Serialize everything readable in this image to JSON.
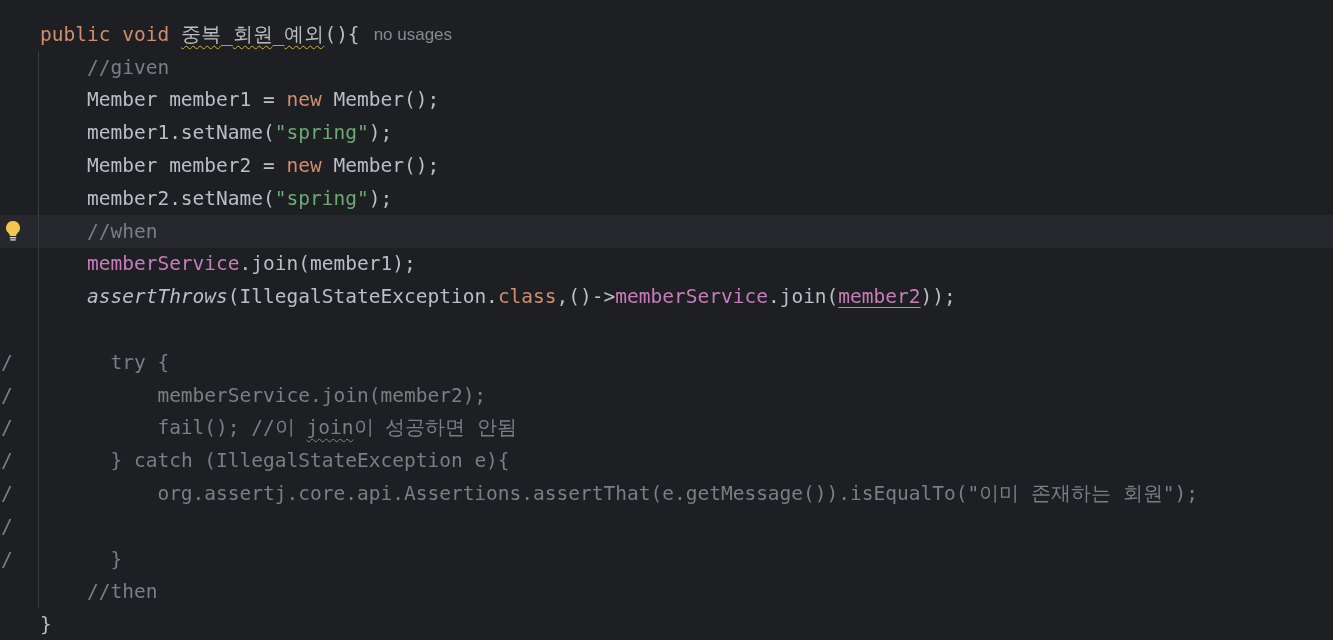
{
  "editor": {
    "header": {
      "tokens": [
        {
          "kind": "keyword",
          "text": "public void "
        },
        {
          "kind": "plain",
          "text": "중복",
          "warning": true
        },
        {
          "kind": "plain",
          "text": "_"
        },
        {
          "kind": "plain",
          "text": "회원",
          "warning": true
        },
        {
          "kind": "plain",
          "text": "_"
        },
        {
          "kind": "plain",
          "text": "예외",
          "warning": true
        },
        {
          "kind": "plain",
          "text": "(){"
        }
      ],
      "hint": "no usages"
    },
    "body": [
      {
        "kind": "statement",
        "current": false,
        "bulb": false,
        "tokens": [
          {
            "kind": "comment",
            "text": "//given"
          }
        ]
      },
      {
        "kind": "statement",
        "current": false,
        "bulb": false,
        "tokens": [
          {
            "kind": "plain",
            "text": "Member member1 = "
          },
          {
            "kind": "keyword",
            "text": "new"
          },
          {
            "kind": "plain",
            "text": " Member();"
          }
        ]
      },
      {
        "kind": "statement",
        "current": false,
        "bulb": false,
        "tokens": [
          {
            "kind": "plain",
            "text": "member1.setName("
          },
          {
            "kind": "string",
            "text": "\"spring\""
          },
          {
            "kind": "plain",
            "text": ");"
          }
        ]
      },
      {
        "kind": "statement",
        "current": false,
        "bulb": false,
        "tokens": [
          {
            "kind": "plain",
            "text": "Member member2 = "
          },
          {
            "kind": "keyword",
            "text": "new"
          },
          {
            "kind": "plain",
            "text": " Member();"
          }
        ]
      },
      {
        "kind": "statement",
        "current": false,
        "bulb": false,
        "tokens": [
          {
            "kind": "plain",
            "text": "member2.setName("
          },
          {
            "kind": "string",
            "text": "\"spring\""
          },
          {
            "kind": "plain",
            "text": ");"
          }
        ]
      },
      {
        "kind": "statement",
        "current": true,
        "bulb": true,
        "tokens": [
          {
            "kind": "comment",
            "text": "//when"
          }
        ]
      },
      {
        "kind": "statement",
        "current": false,
        "bulb": false,
        "tokens": [
          {
            "kind": "field",
            "text": "memberService"
          },
          {
            "kind": "plain",
            "text": ".join(member1);"
          }
        ]
      },
      {
        "kind": "statement",
        "current": false,
        "bulb": false,
        "tokens": [
          {
            "kind": "italic",
            "text": "assertThrows"
          },
          {
            "kind": "plain",
            "text": "(IllegalStateException."
          },
          {
            "kind": "keyword",
            "text": "class"
          },
          {
            "kind": "plain",
            "text": ",()->"
          },
          {
            "kind": "field",
            "text": "memberService"
          },
          {
            "kind": "plain",
            "text": ".join("
          },
          {
            "kind": "field",
            "text": "member2",
            "underlined": true
          },
          {
            "kind": "plain",
            "text": "));"
          }
        ]
      },
      {
        "kind": "blank",
        "current": false,
        "bulb": false
      },
      {
        "kind": "block",
        "current": false,
        "bulb": false,
        "gutter": "/",
        "tokens": [
          {
            "kind": "comment",
            "text": "try {"
          }
        ]
      },
      {
        "kind": "inner",
        "current": false,
        "bulb": false,
        "gutter": "/",
        "tokens": [
          {
            "kind": "comment",
            "text": "memberService.join(member2);"
          }
        ]
      },
      {
        "kind": "inner",
        "current": false,
        "bulb": false,
        "gutter": "/",
        "tokens": [
          {
            "kind": "comment",
            "text": "fail(); //이 "
          },
          {
            "kind": "comment",
            "text": "join",
            "spelling": true
          },
          {
            "kind": "comment",
            "text": "이 성공하면 안됨"
          }
        ]
      },
      {
        "kind": "block",
        "current": false,
        "bulb": false,
        "gutter": "/",
        "tokens": [
          {
            "kind": "comment",
            "text": "} catch (IllegalStateException e){"
          }
        ]
      },
      {
        "kind": "inner",
        "current": false,
        "bulb": false,
        "gutter": "/",
        "tokens": [
          {
            "kind": "comment",
            "text": "org.assertj.core.api.Assertions.assertThat(e.getMessage()).isEqualTo(\"이미 존재하는 회원\");"
          }
        ]
      },
      {
        "kind": "blank",
        "current": false,
        "bulb": false,
        "gutter": "/"
      },
      {
        "kind": "block",
        "current": false,
        "bulb": false,
        "gutter": "/",
        "tokens": [
          {
            "kind": "comment",
            "text": "}"
          }
        ]
      },
      {
        "kind": "statement",
        "current": false,
        "bulb": false,
        "tokens": [
          {
            "kind": "comment",
            "text": "//then"
          }
        ]
      }
    ],
    "closing": {
      "tokens": [
        {
          "kind": "plain",
          "text": "}"
        }
      ]
    }
  }
}
